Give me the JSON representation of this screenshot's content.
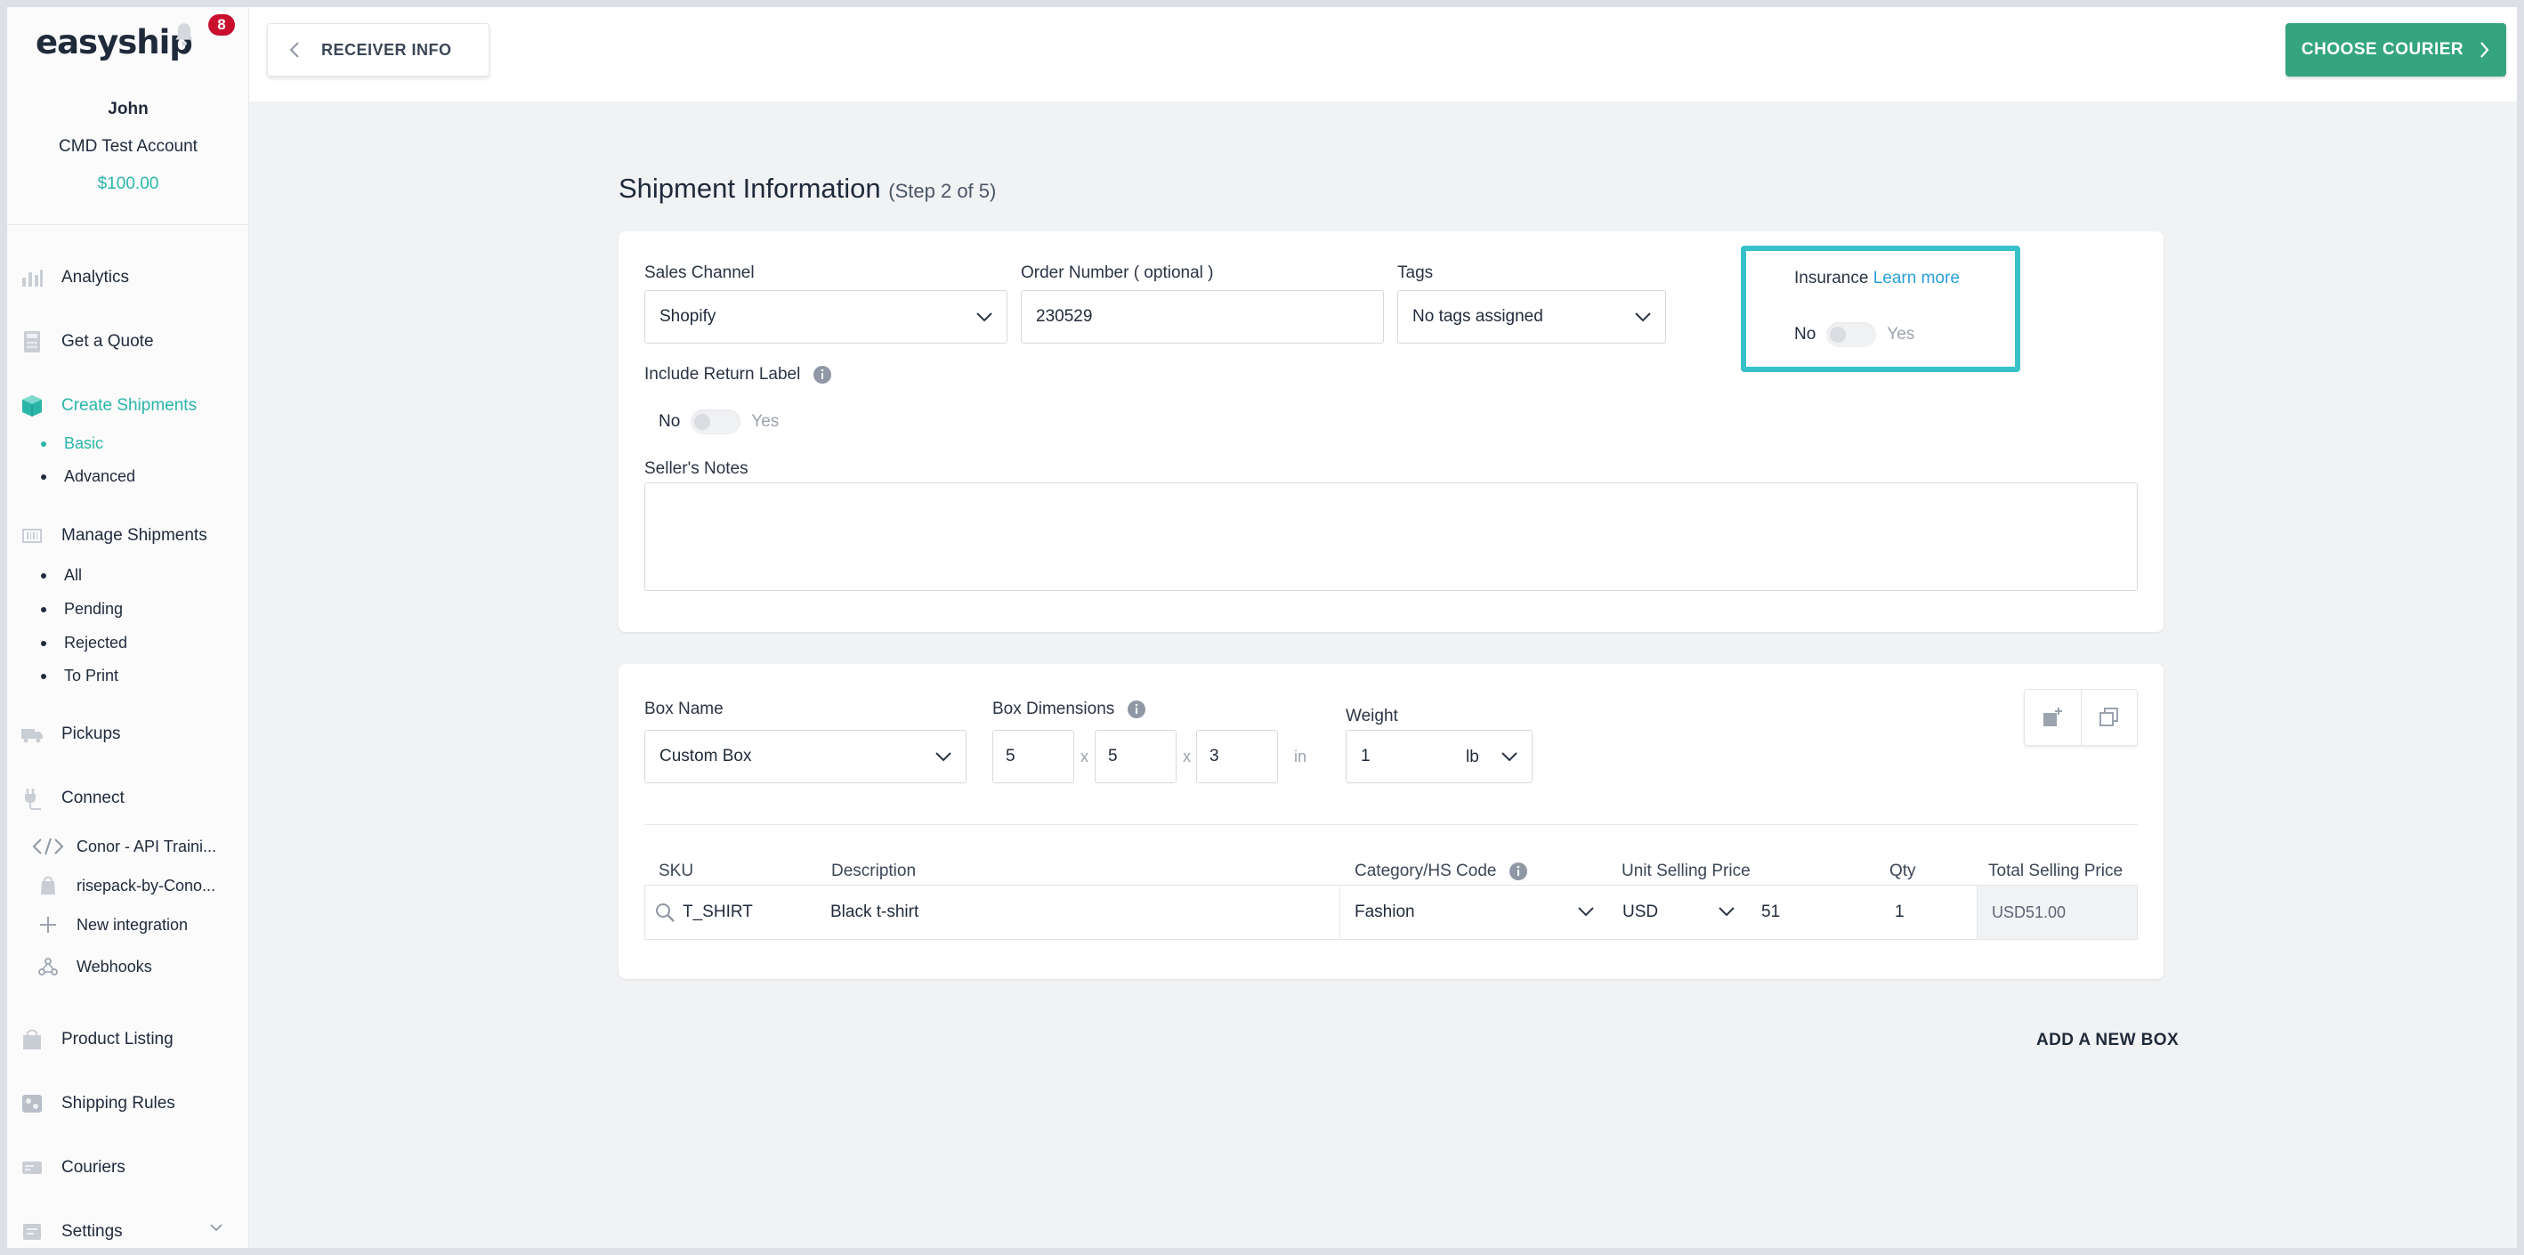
{
  "app": {
    "logo": "easyship",
    "notification_count": "8"
  },
  "user": {
    "name": "John",
    "account": "CMD Test Account",
    "balance": "$100.00"
  },
  "sidebar": {
    "analytics": "Analytics",
    "quote": "Get a Quote",
    "create_shipments": "Create Shipments",
    "create_sub": [
      "Basic",
      "Advanced"
    ],
    "manage_shipments": "Manage Shipments",
    "manage_sub": [
      "All",
      "Pending",
      "Rejected",
      "To Print"
    ],
    "pickups": "Pickups",
    "connect": "Connect",
    "integrations": [
      "Conor - API Traini...",
      "risepack-by-Cono...",
      "New integration",
      "Webhooks"
    ],
    "product_listing": "Product Listing",
    "shipping_rules": "Shipping Rules",
    "couriers": "Couriers",
    "settings": "Settings"
  },
  "topbar": {
    "back_label": "RECEIVER INFO",
    "next_label": "CHOOSE COURIER"
  },
  "page": {
    "title": "Shipment Information",
    "step": "(Step 2 of 5)"
  },
  "shipment": {
    "sales_channel_label": "Sales Channel",
    "sales_channel_value": "Shopify",
    "order_number_label": "Order Number ( optional )",
    "order_number_value": "230529",
    "tags_label": "Tags",
    "tags_value": "No tags assigned",
    "insurance_label": "Insurance",
    "insurance_link": "Learn more",
    "insurance_no": "No",
    "insurance_yes": "Yes",
    "insurance_enabled": false,
    "return_label_label": "Include Return Label",
    "return_no": "No",
    "return_yes": "Yes",
    "return_enabled": false,
    "notes_label": "Seller's Notes",
    "notes_value": ""
  },
  "box": {
    "name_label": "Box Name",
    "name_value": "Custom Box",
    "dims_label": "Box Dimensions",
    "length": "5",
    "width": "5",
    "height": "3",
    "sep": "x",
    "dims_unit": "in",
    "weight_label": "Weight",
    "weight_value": "1",
    "weight_unit": "lb"
  },
  "items": {
    "headers": {
      "sku": "SKU",
      "description": "Description",
      "category": "Category/HS Code",
      "unit_price": "Unit Selling Price",
      "qty": "Qty",
      "total": "Total Selling Price"
    },
    "rows": [
      {
        "sku": "T_SHIRT",
        "description": "Black t-shirt",
        "category": "Fashion",
        "currency": "USD",
        "price": "51",
        "qty": "1",
        "total": "USD51.00"
      }
    ]
  },
  "actions": {
    "add_box": "ADD A NEW BOX"
  },
  "colors": {
    "accent": "#29b6a8",
    "primary_button": "#35a57f",
    "highlight_border": "#37c1c9",
    "link": "#2a9fd8",
    "badge": "#c8102e"
  }
}
